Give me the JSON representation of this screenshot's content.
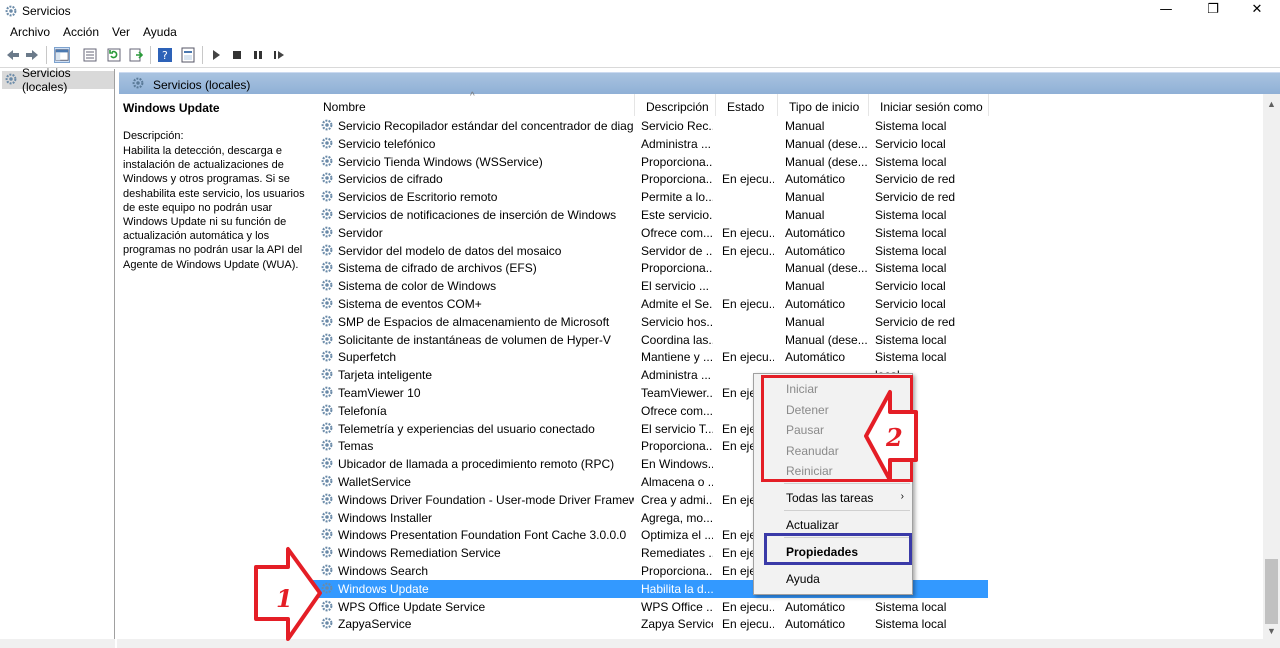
{
  "window": {
    "title": "Servicios"
  },
  "menubar": {
    "items": [
      "Archivo",
      "Acción",
      "Ver",
      "Ayuda"
    ]
  },
  "tree": {
    "root_label": "Servicios (locales)"
  },
  "content_header": {
    "label": "Servicios (locales)"
  },
  "description_pane": {
    "service_title": "Windows Update",
    "label": "Descripción:",
    "text": "Habilita la detección, descarga e instalación de actualizaciones de Windows y otros programas. Si se deshabilita este servicio, los usuarios de este equipo no podrán usar Windows Update ni su función de actualización automática y los programas no podrán usar la API del Agente de Windows Update (WUA)."
  },
  "columns": {
    "name": "Nombre",
    "description": "Descripción",
    "state": "Estado",
    "startup_type": "Tipo de inicio",
    "logon_as": "Iniciar sesión como"
  },
  "services": [
    {
      "name": "Servicio Recopilador estándar del concentrador de diagnó...",
      "desc": "Servicio Rec...",
      "state": "",
      "type": "Manual",
      "logon": "Sistema local"
    },
    {
      "name": "Servicio telefónico",
      "desc": "Administra ...",
      "state": "",
      "type": "Manual (dese...",
      "logon": "Servicio local"
    },
    {
      "name": "Servicio Tienda Windows (WSService)",
      "desc": "Proporciona...",
      "state": "",
      "type": "Manual (dese...",
      "logon": "Sistema local"
    },
    {
      "name": "Servicios de cifrado",
      "desc": "Proporciona...",
      "state": "En ejecu...",
      "type": "Automático",
      "logon": "Servicio de red"
    },
    {
      "name": "Servicios de Escritorio remoto",
      "desc": "Permite a lo...",
      "state": "",
      "type": "Manual",
      "logon": "Servicio de red"
    },
    {
      "name": "Servicios de notificaciones de inserción de Windows",
      "desc": "Este servicio...",
      "state": "",
      "type": "Manual",
      "logon": "Sistema local"
    },
    {
      "name": "Servidor",
      "desc": "Ofrece com...",
      "state": "En ejecu...",
      "type": "Automático",
      "logon": "Sistema local"
    },
    {
      "name": "Servidor del modelo de datos del mosaico",
      "desc": "Servidor de ...",
      "state": "En ejecu...",
      "type": "Automático",
      "logon": "Sistema local"
    },
    {
      "name": "Sistema de cifrado de archivos (EFS)",
      "desc": "Proporciona...",
      "state": "",
      "type": "Manual (dese...",
      "logon": "Sistema local"
    },
    {
      "name": "Sistema de color de Windows",
      "desc": "El servicio ...",
      "state": "",
      "type": "Manual",
      "logon": "Servicio local"
    },
    {
      "name": "Sistema de eventos COM+",
      "desc": "Admite el Se...",
      "state": "En ejecu...",
      "type": "Automático",
      "logon": "Servicio local"
    },
    {
      "name": "SMP de Espacios de almacenamiento de Microsoft",
      "desc": "Servicio hos...",
      "state": "",
      "type": "Manual",
      "logon": "Servicio de red"
    },
    {
      "name": "Solicitante de instantáneas de volumen de Hyper-V",
      "desc": "Coordina las...",
      "state": "",
      "type": "Manual (dese...",
      "logon": "Sistema local"
    },
    {
      "name": "Superfetch",
      "desc": "Mantiene y ...",
      "state": "En ejecu...",
      "type": "Automático",
      "logon": "Sistema local"
    },
    {
      "name": "Tarjeta inteligente",
      "desc": "Administra ...",
      "state": "",
      "type": "",
      "logon": "local"
    },
    {
      "name": "TeamViewer 10",
      "desc": "TeamViewer...",
      "state": "En eje",
      "type": "",
      "logon": "local"
    },
    {
      "name": "Telefonía",
      "desc": "Ofrece com...",
      "state": "",
      "type": "",
      "logon": "de red"
    },
    {
      "name": "Telemetría y experiencias del usuario conectado",
      "desc": "El servicio T...",
      "state": "En eje",
      "type": "",
      "logon": "local"
    },
    {
      "name": "Temas",
      "desc": "Proporciona...",
      "state": "En eje",
      "type": "",
      "logon": "local"
    },
    {
      "name": "Ubicador de llamada a procedimiento remoto (RPC)",
      "desc": "En Windows...",
      "state": "",
      "type": "",
      "logon": "de red"
    },
    {
      "name": "WalletService",
      "desc": "Almacena o ...",
      "state": "",
      "type": "",
      "logon": "local"
    },
    {
      "name": "Windows Driver Foundation - User-mode Driver Framework",
      "desc": "Crea y admi...",
      "state": "En eje",
      "type": "",
      "logon": "local"
    },
    {
      "name": "Windows Installer",
      "desc": "Agrega, mo...",
      "state": "",
      "type": "",
      "logon": "local"
    },
    {
      "name": "Windows Presentation Foundation Font Cache 3.0.0.0",
      "desc": "Optimiza el ...",
      "state": "En eje",
      "type": "",
      "logon": "local"
    },
    {
      "name": "Windows Remediation Service",
      "desc": "Remediates ...",
      "state": "En eje",
      "type": "",
      "logon": "local"
    },
    {
      "name": "Windows Search",
      "desc": "Proporciona...",
      "state": "En eje",
      "type": "",
      "logon": "local"
    },
    {
      "name": "Windows Update",
      "desc": "Habilita la d...",
      "state": "",
      "type": "",
      "logon": "local",
      "selected": true
    },
    {
      "name": "WPS Office Update Service",
      "desc": "WPS Office ...",
      "state": "En ejecu...",
      "type": "Automático",
      "logon": "Sistema local"
    },
    {
      "name": "ZapyaService",
      "desc": "Zapya Service",
      "state": "En ejecu...",
      "type": "Automático",
      "logon": "Sistema local"
    }
  ],
  "context_menu": {
    "start": "Iniciar",
    "stop": "Detener",
    "pause": "Pausar",
    "resume": "Reanudar",
    "restart": "Reiniciar",
    "all_tasks": "Todas las tareas",
    "refresh": "Actualizar",
    "properties": "Propiedades",
    "help": "Ayuda"
  },
  "annotations": {
    "step1": "1",
    "step2": "2"
  },
  "colors": {
    "selection": "#3399ff",
    "annotation_red": "#e41e26",
    "annotation_blue": "#3a3aa8"
  }
}
